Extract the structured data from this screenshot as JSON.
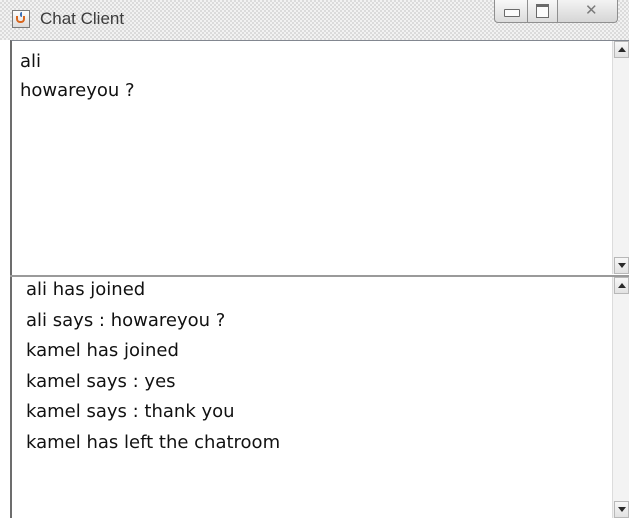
{
  "window": {
    "title": "Chat Client",
    "icon": "java-cup-icon"
  },
  "caption_buttons": {
    "minimize_icon": "minimize-icon",
    "maximize_icon": "maximize-icon",
    "close_icon": "close-icon",
    "close_glyph": "✕"
  },
  "input": {
    "lines": [
      "ali",
      "howareyou ?"
    ]
  },
  "log": {
    "lines": [
      "ali has joined",
      "ali says : howareyou ?",
      "kamel has joined",
      "kamel says : yes",
      "kamel says : thank you",
      "kamel has left the chatroom"
    ]
  },
  "colors": {
    "title_text": "#3c3c3c",
    "pane_border": "#6d6d6d",
    "text": "#111111"
  }
}
